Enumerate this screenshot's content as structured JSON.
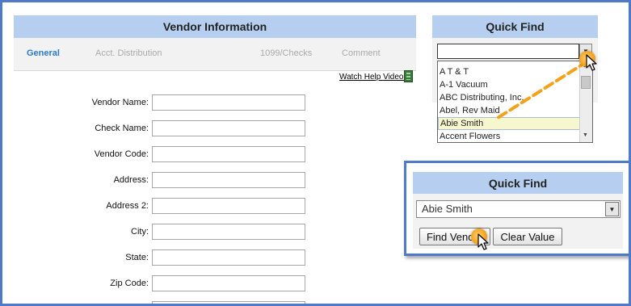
{
  "vendor": {
    "title": "Vendor Information",
    "tabs": [
      {
        "label": "General",
        "active": true
      },
      {
        "label": "Acct. Distribution",
        "active": false
      },
      {
        "label": "1099/Checks",
        "active": false
      },
      {
        "label": "Comment",
        "active": false
      }
    ],
    "help_link": "Watch Help Video!",
    "fields": [
      {
        "label": "Vendor Name:",
        "value": ""
      },
      {
        "label": "Check Name:",
        "value": ""
      },
      {
        "label": "Vendor Code:",
        "value": ""
      },
      {
        "label": "Address:",
        "value": ""
      },
      {
        "label": "Address 2:",
        "value": ""
      },
      {
        "label": "City:",
        "value": ""
      },
      {
        "label": "State:",
        "value": ""
      },
      {
        "label": "Zip Code:",
        "value": ""
      }
    ]
  },
  "quick_find_top": {
    "title": "Quick Find",
    "input_value": "",
    "list_items": [
      "A T & T",
      "A-1 Vacuum",
      "ABC Distributing, Inc.",
      "Abel, Rev Maid",
      "Abie Smith",
      "Accent Flowers"
    ],
    "highlighted_item": "Abie Smith"
  },
  "quick_find_overlay": {
    "title": "Quick Find",
    "selected_value": "Abie Smith",
    "find_button": "Find Vendor",
    "clear_button": "Clear Value"
  },
  "colors": {
    "frame_border": "#4f7ac9",
    "header_bg": "#b6cff0",
    "active_tab": "#2a7bc7",
    "highlight_bg": "#f6f7cf",
    "click_marker": "#f3a21c"
  },
  "icons": {
    "help_video": "film-icon",
    "dropdown": "chevron-down-icon",
    "cursor": "mouse-pointer-icon",
    "click": "click-marker-icon"
  }
}
